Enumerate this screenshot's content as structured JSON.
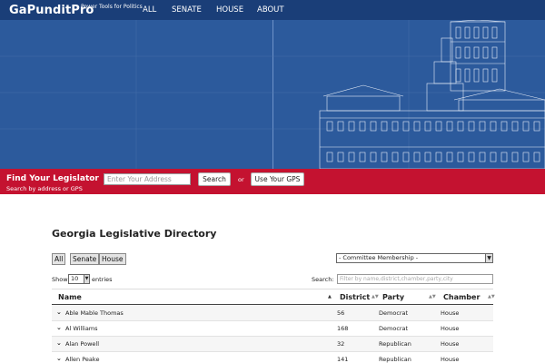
{
  "header": {
    "brand": "GaPunditPro",
    "tagline": "Power Tools for Politics",
    "nav": [
      "ALL",
      "SENATE",
      "HOUSE",
      "ABOUT"
    ]
  },
  "find": {
    "title": "Find Your Legislator",
    "subtitle": "Search by address or GPS",
    "address_placeholder": "Enter Your Address",
    "search_button": "Search",
    "or_label": "or",
    "gps_button": "Use Your GPS"
  },
  "directory": {
    "title": "Georgia Legislative Directory",
    "chamber_filters": [
      "All",
      "Senate",
      "House"
    ],
    "committee_select": "- Committee Membership -",
    "show_label": "Show",
    "entries_value": "10",
    "entries_label": "entries",
    "search_label": "Search:",
    "filter_placeholder": "Filter by name,district,chamber,party,city",
    "columns": [
      "Name",
      "District",
      "Party",
      "Chamber"
    ],
    "rows": [
      {
        "name": "Able Mable Thomas",
        "district": "56",
        "party": "Democrat",
        "chamber": "House"
      },
      {
        "name": "Al Williams",
        "district": "168",
        "party": "Democrat",
        "chamber": "House"
      },
      {
        "name": "Alan Powell",
        "district": "32",
        "party": "Republican",
        "chamber": "House"
      },
      {
        "name": "Allen Peake",
        "district": "141",
        "party": "Republican",
        "chamber": "House"
      }
    ]
  },
  "colors": {
    "nav_bg": "#1a3e78",
    "hero_bg": "#2c5a9c",
    "find_bar": "#c41230"
  }
}
